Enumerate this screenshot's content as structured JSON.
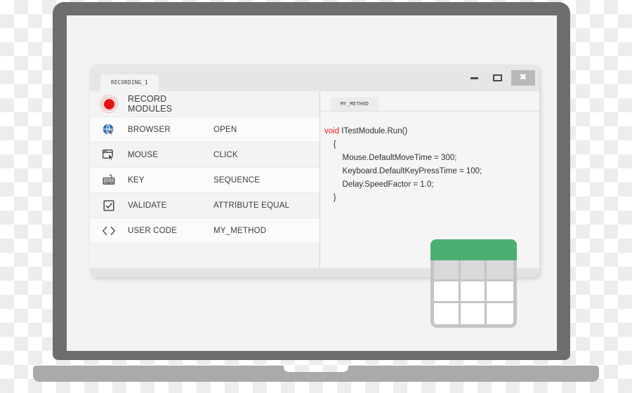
{
  "device": {
    "type": "laptop-mockup",
    "bezel_color": "#6d6e6e",
    "base_color": "#a9aaaa",
    "screen_color": "#f2f2f2"
  },
  "window": {
    "tab_label": "RECORDING_1",
    "controls": {
      "minimize": "minimize-icon",
      "maximize": "maximize-icon",
      "close": "✖"
    }
  },
  "modules_panel": {
    "header": {
      "icon": "record-icon",
      "label": "RECORD MODULES"
    },
    "rows": [
      {
        "icon": "browser-globe-icon",
        "label": "BROWSER",
        "action": "OPEN"
      },
      {
        "icon": "mouse-window-icon",
        "label": "MOUSE",
        "action": "CLICK"
      },
      {
        "icon": "keyboard-icon",
        "label": "KEY",
        "action": "SEQUENCE"
      },
      {
        "icon": "checkbox-check-icon",
        "label": "VALIDATE",
        "action": "ATTRIBUTE EQUAL"
      },
      {
        "icon": "code-brackets-icon",
        "label": "USER CODE",
        "action": "MY_METHOD"
      }
    ]
  },
  "code_panel": {
    "tab_label": "MY_METHOD",
    "keyword": "void",
    "signature": " ITestModule.Run()",
    "lines": [
      "    {",
      "        Mouse.DefaultMoveTime = 300;",
      "        Keyboard.DefaultKeyPressTime = 100;",
      "        Delay.SpeedFactor = 1.0;",
      "    }"
    ],
    "keyword_color": "#ee1c1c",
    "text_color": "#2f2f2f"
  },
  "spreadsheet_badge": {
    "name": "spreadsheet-icon",
    "header_color": "#4caf72",
    "grid_color": "#c4c4c4",
    "rows": 3,
    "columns": 3
  }
}
